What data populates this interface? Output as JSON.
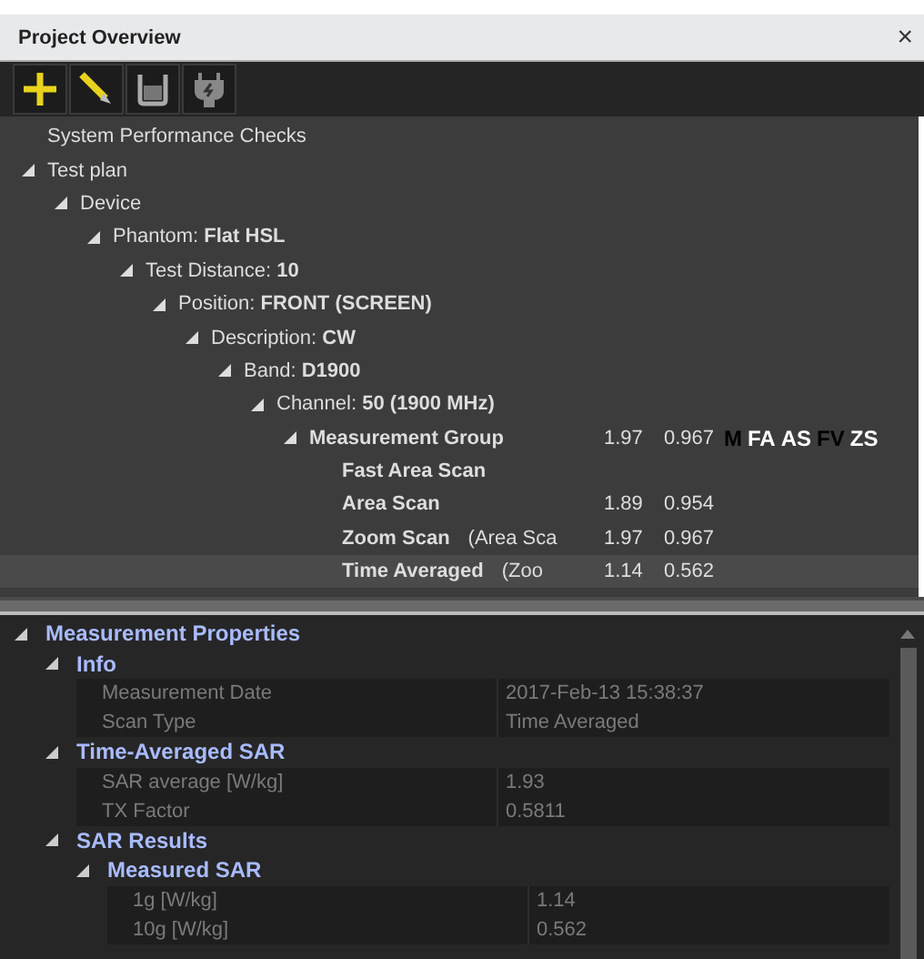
{
  "window": {
    "title": "Project Overview",
    "close": "×"
  },
  "toolbar": [
    {
      "kind": "add"
    },
    {
      "kind": "edit"
    },
    {
      "kind": "container"
    },
    {
      "kind": "plug"
    }
  ],
  "tree": [
    {
      "label": "System Performance Checks",
      "selected": false
    },
    {
      "label": "Test plan",
      "expanded": true,
      "selected": false,
      "children": [
        {
          "label": "Device",
          "expanded": true,
          "selected": false,
          "children": [
            {
              "label": "Phantom:",
              "value": "Flat HSL",
              "expanded": true,
              "selected": false,
              "children": [
                {
                  "label": "Test Distance:",
                  "value": "10",
                  "expanded": true,
                  "selected": false,
                  "children": [
                    {
                      "label": "Position:",
                      "value": "FRONT (SCREEN)",
                      "expanded": true,
                      "selected": false,
                      "children": [
                        {
                          "label": "Description:",
                          "value": "CW",
                          "expanded": true,
                          "selected": false,
                          "children": [
                            {
                              "label": "Band:",
                              "value": "D1900",
                              "expanded": true,
                              "selected": false,
                              "children": [
                                {
                                  "label": "Channel:",
                                  "value": "50 (1900 MHz)",
                                  "expanded": true,
                                  "selected": false,
                                  "children": [
                                    {
                                      "label": "Measurement Group",
                                      "bold": true,
                                      "col1": "1.97",
                                      "col2": "0.967",
                                      "expanded": true,
                                      "selected": false,
                                      "tags": [
                                        {
                                          "text": "M",
                                          "color": "#000000"
                                        },
                                        {
                                          "text": "FA",
                                          "color": "#ffffff"
                                        },
                                        {
                                          "text": "AS",
                                          "color": "#ffffff"
                                        },
                                        {
                                          "text": "FV",
                                          "color": "#000000"
                                        },
                                        {
                                          "text": "ZS",
                                          "color": "#ffffff"
                                        }
                                      ],
                                      "children": [
                                        {
                                          "label": "Fast Area Scan",
                                          "bold": true,
                                          "selected": false
                                        },
                                        {
                                          "label": "Area Scan",
                                          "bold": true,
                                          "col1": "1.89",
                                          "col2": "0.954",
                                          "selected": false
                                        },
                                        {
                                          "label": "Zoom Scan",
                                          "bold": true,
                                          "note": "(Area Sca",
                                          "col1": "1.97",
                                          "col2": "0.967",
                                          "selected": false
                                        },
                                        {
                                          "label": "Time Averaged",
                                          "bold": true,
                                          "note": "(Zoo",
                                          "col1": "1.14",
                                          "col2": "0.562",
                                          "selected": true
                                        }
                                      ]
                                    }
                                  ]
                                }
                              ]
                            }
                          ]
                        }
                      ]
                    }
                  ]
                }
              ]
            }
          ]
        }
      ]
    }
  ],
  "properties": [
    {
      "label": "Measurement Properties",
      "expanded": true,
      "children": [
        {
          "label": "Info",
          "expanded": true,
          "rows": [
            {
              "name": "Measurement Date",
              "value": "2017-Feb-13 15:38:37"
            },
            {
              "name": "Scan Type",
              "value": "Time Averaged"
            }
          ]
        },
        {
          "label": "Time-Averaged SAR",
          "expanded": true,
          "rows": [
            {
              "name": "SAR average [W/kg]",
              "value": "1.93"
            },
            {
              "name": "TX Factor",
              "value": "0.5811"
            }
          ]
        },
        {
          "label": "SAR Results",
          "expanded": true,
          "children": [
            {
              "label": "Measured SAR",
              "expanded": true,
              "rows": [
                {
                  "name": "1g [W/kg]",
                  "value": "1.14"
                },
                {
                  "name": "10g [W/kg]",
                  "value": "0.562"
                }
              ]
            }
          ]
        }
      ]
    }
  ]
}
